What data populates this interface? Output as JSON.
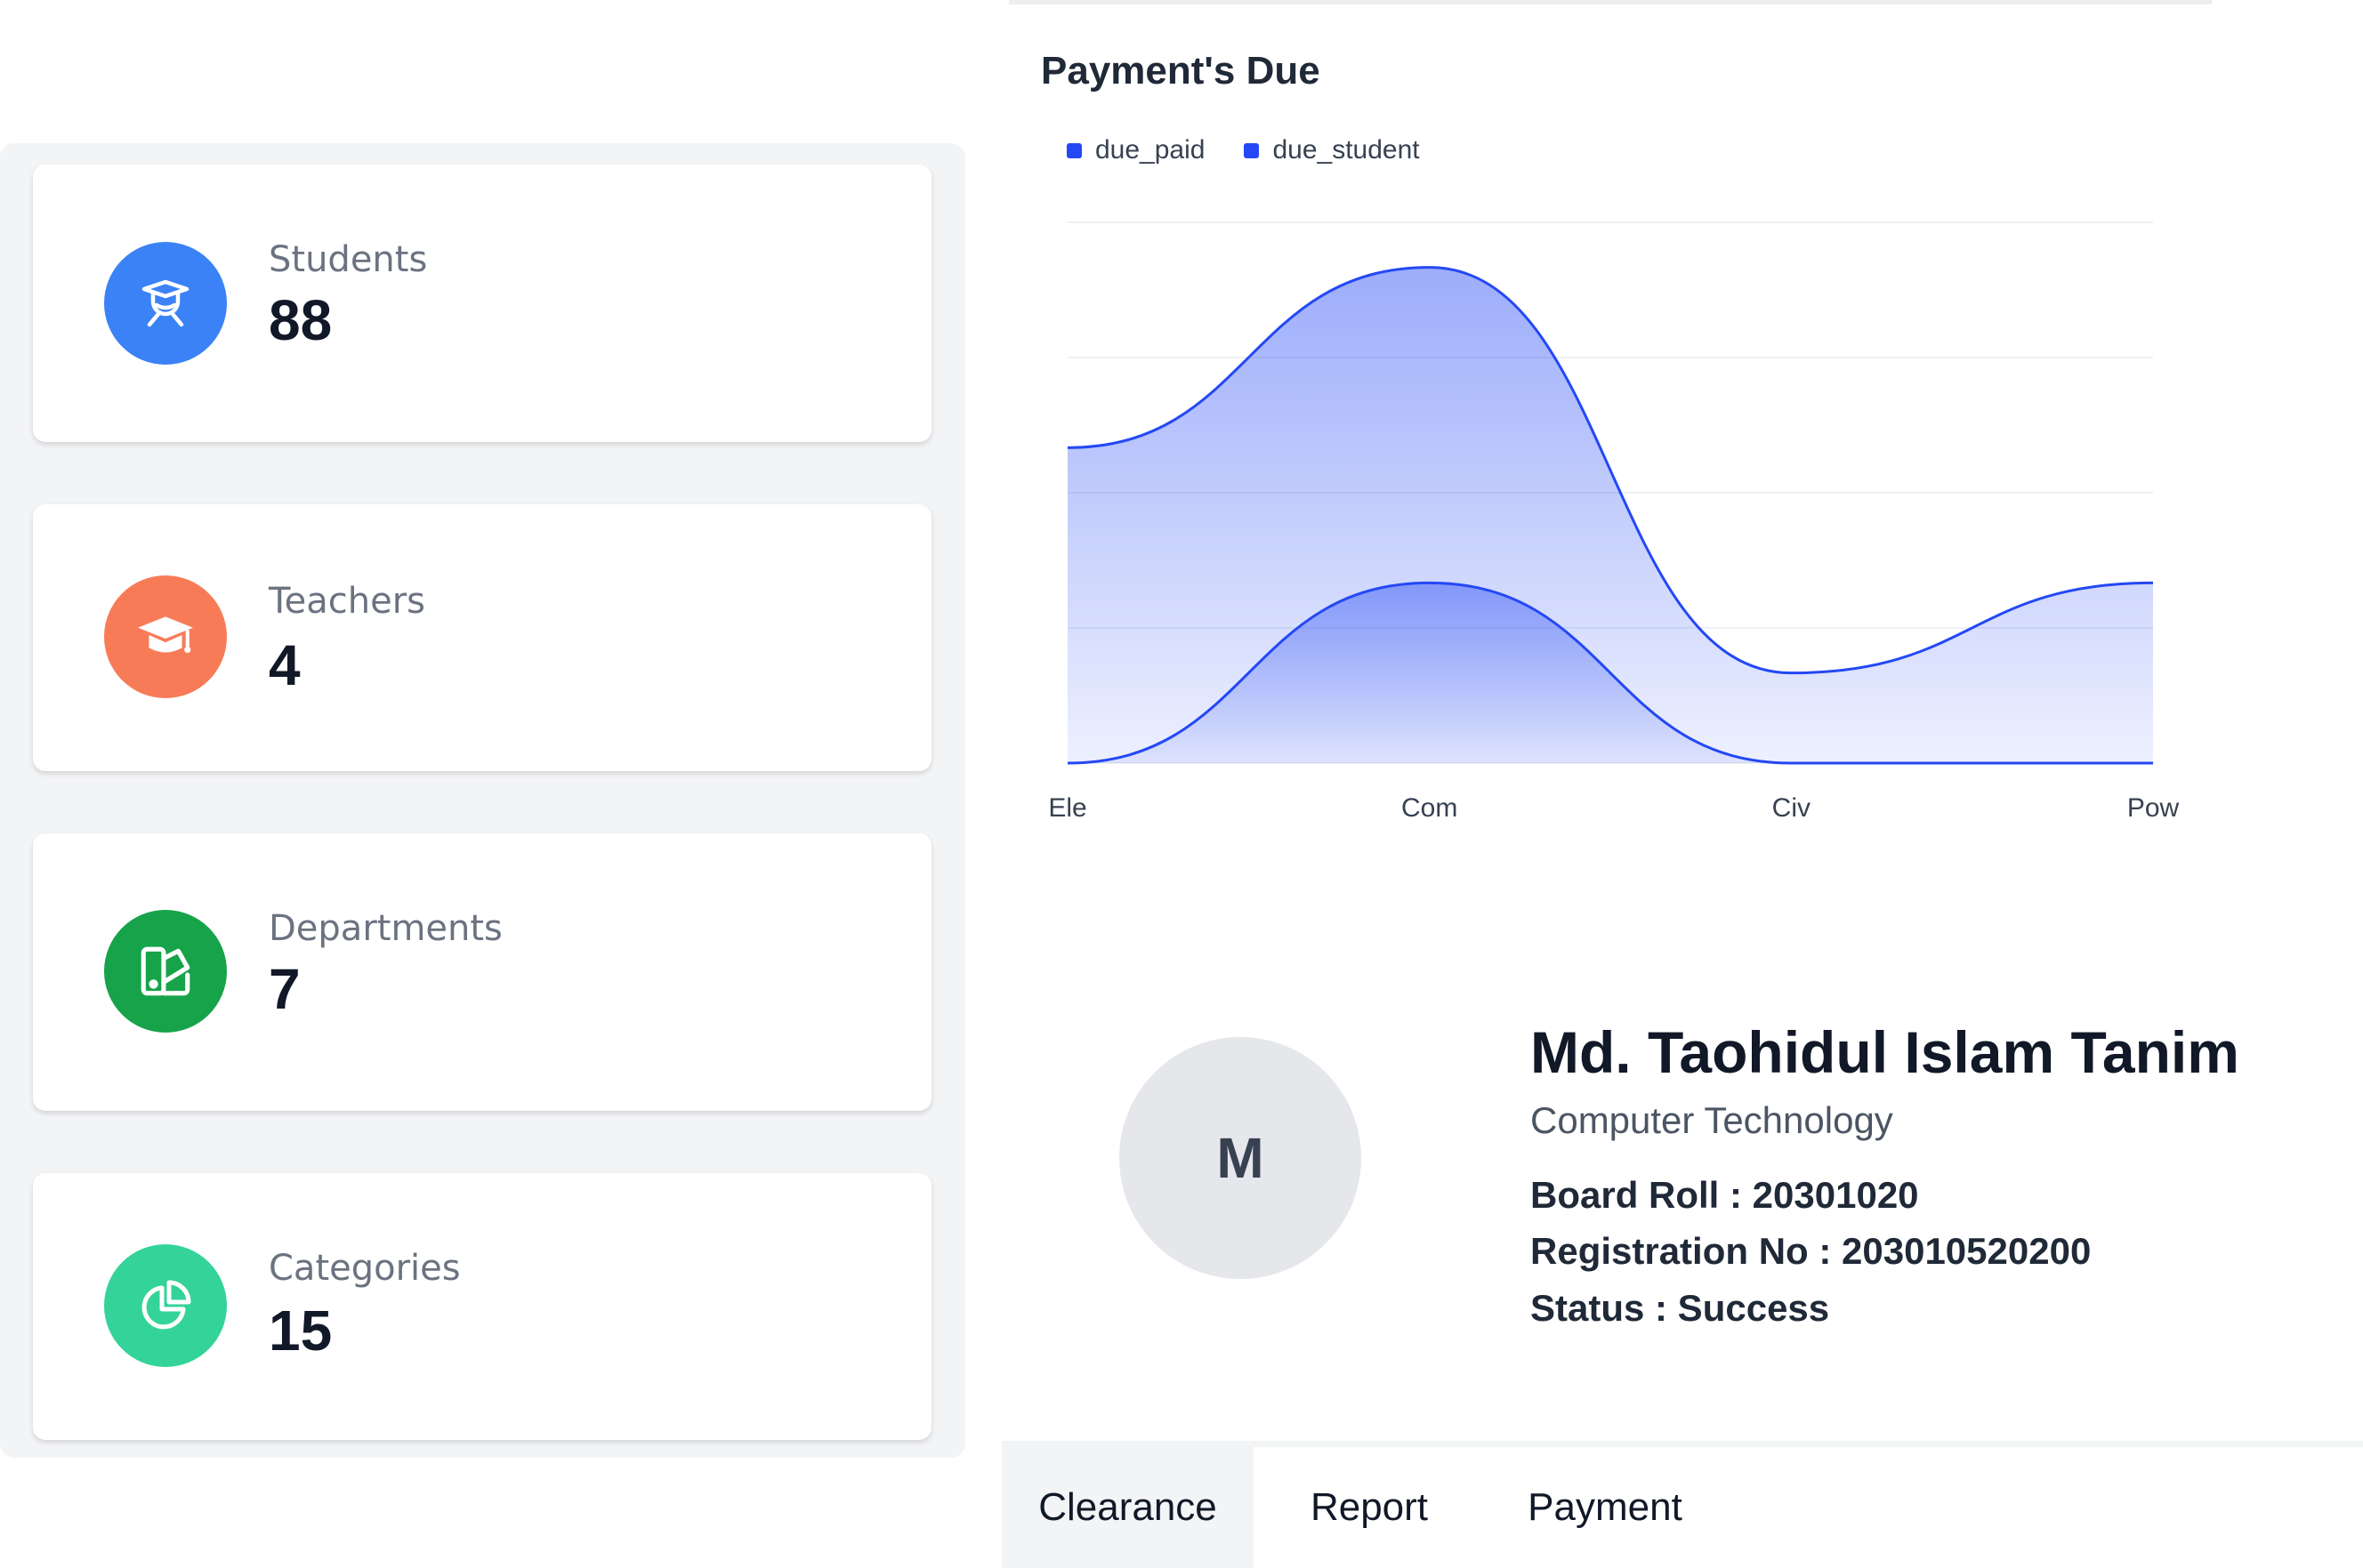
{
  "stats": [
    {
      "label": "Students",
      "value": "88",
      "icon": "graduate-icon",
      "color": "#3b82f6"
    },
    {
      "label": "Teachers",
      "value": "4",
      "icon": "mortarboard-icon",
      "color": "#f87b58"
    },
    {
      "label": "Departments",
      "value": "7",
      "icon": "building-icon",
      "color": "#16a34a"
    },
    {
      "label": "Categories",
      "value": "15",
      "icon": "pie-chart-icon",
      "color": "#34d399"
    }
  ],
  "chart": {
    "title": "Payment's Due",
    "legend": [
      {
        "name": "due_paid",
        "color": "#2448f5"
      },
      {
        "name": "due_student",
        "color": "#2448f5"
      }
    ]
  },
  "chart_data": {
    "type": "area",
    "categories": [
      "Ele",
      "Com",
      "Civ",
      "Pow"
    ],
    "series": [
      {
        "name": "due_paid",
        "values": [
          0,
          4,
          0,
          0
        ]
      },
      {
        "name": "due_student",
        "values": [
          7,
          11,
          2,
          4
        ]
      }
    ],
    "ylim": [
      0,
      12
    ],
    "grid": true,
    "legend_position": "top-left"
  },
  "profile": {
    "avatar_initial": "M",
    "name": "Md. Taohidul Islam Tanim",
    "department": "Computer Technology",
    "board_roll": "Board Roll : 20301020",
    "registration": "Registration No : 203010520200",
    "status": "Status : Success"
  },
  "tabs": [
    {
      "label": "Clearance",
      "active": true
    },
    {
      "label": "Report",
      "active": false
    },
    {
      "label": "Payment",
      "active": false
    }
  ]
}
